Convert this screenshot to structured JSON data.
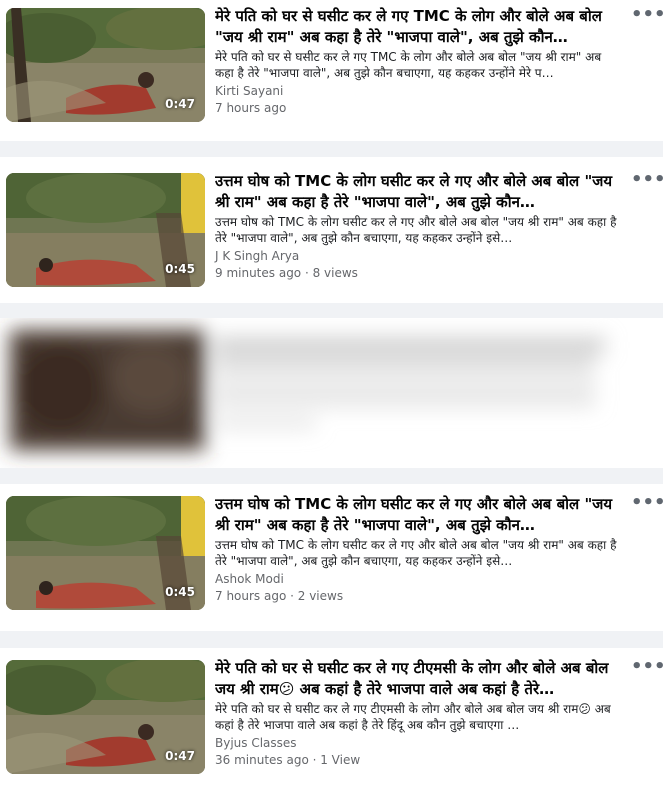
{
  "more_label": "•••",
  "results": [
    {
      "title": "मेरे पति को घर से घसीट कर ले गए TMC के लोग और बोले अब बोल \"जय श्री राम\" अब कहा है तेरे \"भाजपा वाले\", अब तुझे कौन…",
      "description": "मेरे पति को घर से घसीट कर ले गए TMC के लोग और बोले अब बोल \"जय श्री राम\" अब कहा है तेरे \"भाजपा वाले\", अब तुझे कौन बचाएगा, यह कहकर उन्होंने मेरे प…",
      "author": "Kirti Sayani",
      "meta": "7 hours ago",
      "duration": "0:47"
    },
    {
      "title": "उत्तम घोष को TMC के लोग घसीट कर ले गए और बोले अब बोल \"जय श्री राम\" अब कहा है तेरे \"भाजपा वाले\", अब तुझे कौन…",
      "description": "उत्तम घोष को TMC के लोग घसीट कर ले गए और बोले अब बोल \"जय श्री राम\" अब कहा है तेरे \"भाजपा वाले\", अब तुझे कौन बचाएगा, यह कहकर उन्होंने इसे…",
      "author": "J K Singh Arya",
      "meta": "9 minutes ago · 8 views",
      "duration": "0:45"
    },
    {
      "title": "उत्तम घोष को TMC के लोग घसीट कर ले गए और बोले अब बोल \"जय श्री राम\" अब कहा है तेरे \"भाजपा वाले\", अब तुझे कौन…",
      "description": "उत्तम घोष को TMC के लोग घसीट कर ले गए और बोले अब बोल \"जय श्री राम\" अब कहा है तेरे \"भाजपा वाले\", अब तुझे कौन बचाएगा, यह कहकर उन्होंने इसे…",
      "author": "Ashok Modi",
      "meta": "7 hours ago · 2 views",
      "duration": "0:45"
    },
    {
      "title": "मेरे पति को घर से घसीट कर ले गए टीएमसी के लोग और बोले अब बोल जय श्री राम😕 अब कहां है तेरे भाजपा वाले अब कहां है तेरे…",
      "description": "मेरे पति को घर से घसीट कर ले गए टीएमसी के लोग और बोले अब बोल जय श्री राम😕 अब कहां है तेरे भाजपा वाले अब कहां है तेरे हिंदू अब कौन तुझे बचाएगा …",
      "author": "Byjus Classes",
      "meta": "36 minutes ago · 1 View",
      "duration": "0:47"
    }
  ]
}
